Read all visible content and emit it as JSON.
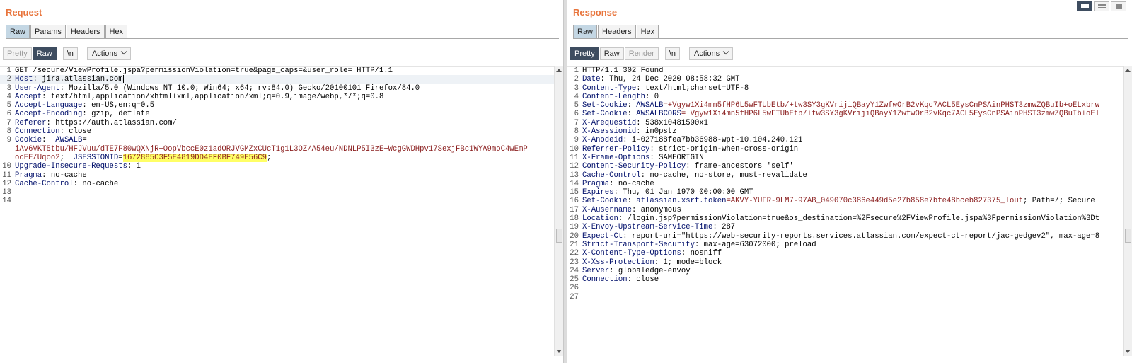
{
  "request": {
    "title": "Request",
    "tabs": [
      "Raw",
      "Params",
      "Headers",
      "Hex"
    ],
    "active_tab": "Raw",
    "toolbar": {
      "pretty": "Pretty",
      "raw": "Raw",
      "newline": "\\n",
      "actions": "Actions"
    },
    "lines": {
      "l1": "GET /secure/ViewProfile.jspa?permissionViolation=true&page_caps=&user_role= HTTP/1.1",
      "l2k": "Host",
      "l2v": ": jira.atlassian.com",
      "l3k": "User-Agent",
      "l3v": ": Mozilla/5.0 (Windows NT 10.0; Win64; x64; rv:84.0) Gecko/20100101 Firefox/84.0",
      "l4k": "Accept",
      "l4v": ": text/html,application/xhtml+xml,application/xml;q=0.9,image/webp,*/*;q=0.8",
      "l5k": "Accept-Language",
      "l5v": ": en-US,en;q=0.5",
      "l6k": "Accept-Encoding",
      "l6v": ": gzip, deflate",
      "l7k": "Referer",
      "l7v": ": https://auth.atlassian.com/",
      "l8k": "Connection",
      "l8v": ": close",
      "l9k": "Cookie",
      "l9a": ":  ",
      "l9b": "AWSALB",
      "l9c": "=",
      "l9d": "iAv6VKT5tbu/HFJVuu/dTE7P80wQXNjR+OopVbccE0z1adORJVGMZxCUcT1g1L3OZ/A54eu/NDNLP5I3zE+WcgGWDHpv17SexjFBc1WYA9moC4wEmP",
      "l9e": "ooEE/Uqoo2",
      "l9f": ";  ",
      "l9g": "JSESSIONID",
      "l9h": "=",
      "l9i": "1672885C3F5E4819DD4EF0BF749E56C9",
      "l9j": ";",
      "l10k": "Upgrade-Insecure-Requests",
      "l10v": ": 1",
      "l11k": "Pragma",
      "l11v": ": no-cache",
      "l12k": "Cache-Control",
      "l12v": ": no-cache"
    }
  },
  "response": {
    "title": "Response",
    "tabs": [
      "Raw",
      "Headers",
      "Hex"
    ],
    "active_tab": "Raw",
    "toolbar": {
      "pretty": "Pretty",
      "raw": "Raw",
      "render": "Render",
      "newline": "\\n",
      "actions": "Actions"
    },
    "lines": {
      "l1": "HTTP/1.1 302 Found",
      "l2k": "Date",
      "l2v": ": Thu, 24 Dec 2020 08:58:32 GMT",
      "l3k": "Content-Type",
      "l3v": ": text/html;charset=UTF-8",
      "l4k": "Content-Length",
      "l4v": ": 0",
      "l5k": "Set-Cookie",
      "l5a": ": ",
      "l5b": "AWSALB",
      "l5c": "=+Vgyw1Xi4mn5fHP6L5wFTUbEtb/+tw3SY3gKVrijiQBayY1ZwfwOrB2vKqc7ACL5EysCnPSAinPHST3zmwZQBuIb+oELxbrw",
      "l6k": "Set-Cookie",
      "l6a": ": ",
      "l6b": "AWSALBCORS",
      "l6c": "=+Vgyw1Xi4mn5fHP6L5wFTUbEtb/+tw3SY3gKVrijiQBayY1ZwfwOrB2vKqc7ACL5EysCnPSAinPHST3zmwZQBuIb+oEl",
      "l7k": "X-Arequestid",
      "l7v": ": 538x10481590x1",
      "l8k": "X-Asessionid",
      "l8v": ": in0pstz",
      "l9k": "X-Anodeid",
      "l9v": ": i-027188fea7bb36988-wpt-10.104.240.121",
      "l10k": "Referrer-Policy",
      "l10v": ": strict-origin-when-cross-origin",
      "l11k": "X-Frame-Options",
      "l11v": ": SAMEORIGIN",
      "l12k": "Content-Security-Policy",
      "l12v": ": frame-ancestors 'self'",
      "l13k": "Cache-Control",
      "l13v": ": no-cache, no-store, must-revalidate",
      "l14k": "Pragma",
      "l14v": ": no-cache",
      "l15k": "Expires",
      "l15v": ": Thu, 01 Jan 1970 00:00:00 GMT",
      "l16k": "Set-Cookie",
      "l16a": ": ",
      "l16b": "atlassian.xsrf.token",
      "l16c": "=AKVY-YUFR-9LM7-97AB_049070c386e449d5e27b858e7bfe48bceb827375_lout",
      "l16d": "; Path=/; Secure",
      "l17k": "X-Ausername",
      "l17v": ": anonymous",
      "l18k": "Location",
      "l18v": ": /login.jsp?permissionViolation=true&os_destination=%2Fsecure%2FViewProfile.jspa%3FpermissionViolation%3Dt",
      "l19k": "X-Envoy-Upstream-Service-Time",
      "l19v": ": 287",
      "l20k": "Expect-Ct",
      "l20v": ": report-uri=\"https://web-security-reports.services.atlassian.com/expect-ct-report/jac-gedgev2\", max-age=8",
      "l21k": "Strict-Transport-Security",
      "l21v": ": max-age=63072000; preload",
      "l22k": "X-Content-Type-Options",
      "l22v": ": nosniff",
      "l23k": "X-Xss-Protection",
      "l23v": ": 1; mode=block",
      "l24k": "Server",
      "l24v": ": globaledge-envoy",
      "l25k": "Connection",
      "l25v": ": close"
    }
  },
  "layout_buttons": [
    "split-horizontal-icon",
    "split-vertical-icon",
    "tabbed-icon"
  ],
  "colors": {
    "title": "#e8743b",
    "active_toolbar": "#3e4d60",
    "header_key": "#000f6b",
    "value": "#8b1f1f",
    "selection": "#ffff66"
  }
}
